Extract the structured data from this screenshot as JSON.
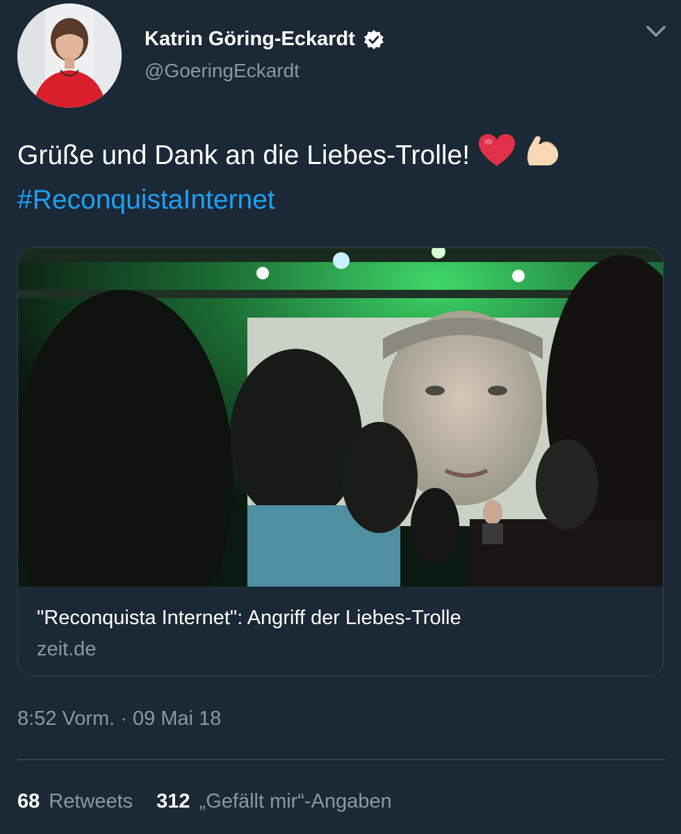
{
  "author": {
    "name": "Katrin Göring-Eckardt",
    "handle": "@GoeringEckardt",
    "verified": true
  },
  "tweet": {
    "text": "Grüße und Dank an die Liebes-Trolle!",
    "emojis": [
      "red-heart",
      "flexed-biceps"
    ],
    "hashtag": "#ReconquistaInternet"
  },
  "card": {
    "title": "\"Reconquista Internet\": Angriff der Liebes-Trolle",
    "domain": "zeit.de"
  },
  "meta": {
    "timestamp": "8:52 Vorm. · 09 Mai 18"
  },
  "stats": {
    "retweets_count": "68",
    "retweets_label": "Retweets",
    "likes_count": "312",
    "likes_label": "„Gefällt mir“-Angaben"
  },
  "colors": {
    "background": "#1b2836",
    "accent": "#1da1f2",
    "secondary_text": "#8899a6",
    "border": "#38444d"
  }
}
